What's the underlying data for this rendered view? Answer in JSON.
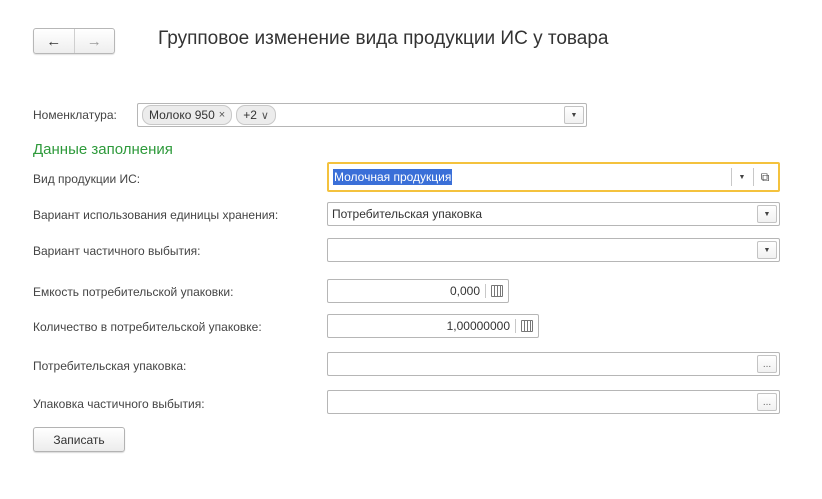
{
  "nav": {
    "back_icon": "←",
    "forward_icon": "→"
  },
  "window": {
    "title": "Групповое изменение вида продукции ИС у товара"
  },
  "form": {
    "nomenclature": {
      "label": "Номенклатура:",
      "tag_value": "Молоко 950",
      "tag_close": "×",
      "more": "+2",
      "more_icon": "∨"
    },
    "section_title": "Данные заполнения",
    "product_type": {
      "label": "Вид продукции ИС:",
      "value": "Молочная продукция"
    },
    "storage_unit_variant": {
      "label": "Вариант использования единицы хранения:",
      "value": "Потребительская упаковка"
    },
    "partial_disposal_variant": {
      "label": "Вариант частичного выбытия:",
      "value": ""
    },
    "consumer_pack_capacity": {
      "label": "Емкость потребительской упаковки:",
      "value": "0,000"
    },
    "consumer_pack_quantity": {
      "label": "Количество в потребительской упаковке:",
      "value": "1,00000000"
    },
    "consumer_pack": {
      "label": "Потребительская упаковка:",
      "value": "",
      "button": "..."
    },
    "partial_disposal_pack": {
      "label": "Упаковка частичного выбытия:",
      "value": "",
      "button": "..."
    },
    "save_button": "Записать"
  },
  "icons": {
    "dropdown": "▼",
    "open": "⧉"
  },
  "colors": {
    "section": "#2e9a3b",
    "focus_border": "#f4c23d",
    "selection": "#3a6fd8"
  }
}
